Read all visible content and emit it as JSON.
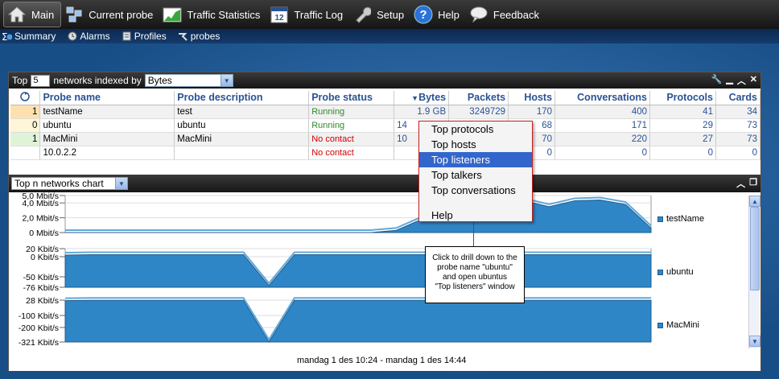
{
  "toolbar": {
    "items": [
      {
        "label": "Main",
        "icon": "home-icon"
      },
      {
        "label": "Current probe",
        "icon": "probe-icon"
      },
      {
        "label": "Traffic Statistics",
        "icon": "chart-icon"
      },
      {
        "label": "Traffic Log",
        "icon": "calendar-icon"
      },
      {
        "label": "Setup",
        "icon": "wrench-icon"
      },
      {
        "label": "Help",
        "icon": "help-icon"
      },
      {
        "label": "Feedback",
        "icon": "speech-bubble-icon"
      }
    ],
    "calendar_day": "12"
  },
  "subnav": {
    "items": [
      {
        "label": "Summary",
        "icon": "sigma-icon"
      },
      {
        "label": "Alarms",
        "icon": "alarm-icon"
      },
      {
        "label": "Profiles",
        "icon": "profiles-icon"
      },
      {
        "label": "probes",
        "icon": "probes-icon"
      }
    ]
  },
  "panel": {
    "prefix": "Top",
    "top_n": "5",
    "mid": "networks indexed by",
    "index_by": "Bytes"
  },
  "table": {
    "columns": [
      "Probe name",
      "Probe description",
      "Probe status",
      "Bytes",
      "Packets",
      "Hosts",
      "Conversations",
      "Protocols",
      "Cards"
    ],
    "rows": [
      {
        "idx": "1",
        "name": "testName",
        "desc": "test",
        "status": "Running",
        "bytes": "1.9 GB",
        "packets": "3249729",
        "hosts": "170",
        "conv": "400",
        "protocols": "41",
        "cards": "34"
      },
      {
        "idx": "0",
        "name": "ubuntu",
        "desc": "ubuntu",
        "status": "Running",
        "bytes": "14",
        "packets": "",
        "hosts": "68",
        "conv": "171",
        "protocols": "29",
        "cards": "73"
      },
      {
        "idx": "1",
        "name": "MacMini",
        "desc": "MacMini",
        "status": "No contact",
        "bytes": "10",
        "packets": "",
        "hosts": "70",
        "conv": "220",
        "protocols": "27",
        "cards": "73"
      },
      {
        "idx": "",
        "name": "10.0.2.2",
        "desc": "",
        "status": "No contact",
        "bytes": "",
        "packets": "",
        "hosts": "0",
        "conv": "0",
        "protocols": "0",
        "cards": "0"
      }
    ]
  },
  "chart_panel": {
    "selector": "Top n networks chart"
  },
  "chart_data": [
    {
      "type": "area",
      "series": [
        {
          "name": "testName",
          "values": [
            0,
            0,
            0,
            0,
            0,
            0,
            0,
            0,
            0,
            0,
            0,
            0,
            0,
            0.3,
            1.8,
            2.8,
            3.0,
            3.2,
            4.3,
            3.5,
            4.3,
            4.4,
            3.8,
            0.6
          ]
        }
      ],
      "y_ticks": [
        "5,0 Mbit/s",
        "4,0 Mbit/s",
        "2,0 Mbit/s",
        "0 Mbit/s"
      ],
      "ylim": [
        0,
        5
      ],
      "grid": true
    },
    {
      "type": "area",
      "series": [
        {
          "name": "ubuntu",
          "values": [
            4,
            5,
            5,
            5,
            5,
            5,
            5,
            5,
            -72,
            5,
            5,
            5,
            5,
            5,
            5,
            5,
            5,
            5,
            5,
            5,
            5,
            5,
            5,
            5
          ]
        }
      ],
      "y_ticks": [
        "20 Kbit/s",
        "0 Kbit/s",
        "-50 Kbit/s",
        "-76 Kbit/s"
      ],
      "ylim": [
        -76,
        20
      ],
      "grid": true
    },
    {
      "type": "area",
      "series": [
        {
          "name": "MacMini",
          "values": [
            24,
            26,
            26,
            26,
            26,
            26,
            26,
            26,
            -321,
            26,
            26,
            26,
            26,
            26,
            26,
            26,
            26,
            26,
            26,
            26,
            26,
            26,
            26,
            26
          ]
        }
      ],
      "y_ticks": [
        "28 Kbit/s",
        "-100 Kbit/s",
        "-200 Kbit/s",
        "-321 Kbit/s"
      ],
      "ylim": [
        -321,
        28
      ],
      "grid": true
    }
  ],
  "chart_xlabel": "mandag 1 des 10:24 - mandag 1 des 14:44",
  "context_menu": {
    "items": [
      "Top protocols",
      "Top hosts",
      "Top listeners",
      "Top talkers",
      "Top conversations",
      "Help"
    ],
    "highlighted": "Top listeners"
  },
  "tooltip": {
    "lines": [
      "Click to drill down to the",
      "probe name \"ubuntu\"",
      "and open ubuntus",
      "\"Top listeners\" window"
    ]
  },
  "colors": {
    "accent": "#2a5294",
    "area_fill": "#2f86c6",
    "running": "#2e8a2e",
    "no_contact": "#d00000",
    "menu_highlight": "#3366cc"
  }
}
